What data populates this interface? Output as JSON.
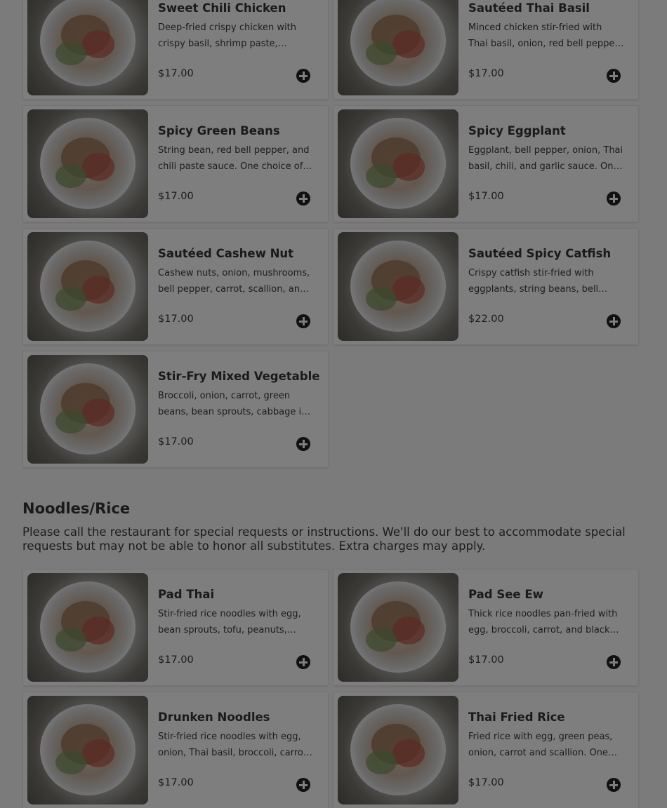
{
  "sections": [
    {
      "items": [
        {
          "name": "Sweet Chili Chicken",
          "desc": "Deep-fried crispy chicken with crispy basil, shrimp paste, sesame seeds and sweet chili sauce.",
          "price": "$17.00",
          "image": "dish-photo"
        },
        {
          "name": "Sautéed Thai Basil",
          "desc": "Minced chicken stir-fried with Thai basil, onion, red bell pepper, and chili garlic sauce.",
          "price": "$17.00",
          "image": "dish-photo"
        },
        {
          "name": "Spicy Green Beans",
          "desc": "String bean, red bell pepper, and chili paste sauce. One choice of protein.",
          "price": "$17.00",
          "image": "dish-photo"
        },
        {
          "name": "Spicy Eggplant",
          "desc": "Eggplant, bell pepper, onion, Thai basil, chili, and garlic sauce. One choice of protein.",
          "price": "$17.00",
          "image": "dish-photo"
        },
        {
          "name": "Sautéed Cashew Nut",
          "desc": "Cashew nuts, onion, mushrooms, bell pepper, carrot, scallion, and roasted chili sauce.",
          "price": "$17.00",
          "image": "dish-photo"
        },
        {
          "name": "Sautéed Spicy Catfish",
          "desc": "Crispy catfish stir-fried with eggplants, string beans, bell pepper and curry paste.",
          "price": "$22.00",
          "image": "dish-photo"
        },
        {
          "name": "Stir-Fry Mixed Vegetables",
          "desc": "Broccoli, onion, carrot, green beans, bean sprouts, cabbage in garlic sauce.",
          "price": "$17.00",
          "image": "dish-photo"
        }
      ]
    },
    {
      "title": "Noodles/Rice",
      "note": "Please call the restaurant for special requests or instructions. We'll do our best to accommodate special requests but may not be able to honor all substitutes. Extra charges may apply.",
      "items": [
        {
          "name": "Pad Thai",
          "desc": "Stir-fried rice noodles with egg, bean sprouts, tofu, peanuts, green onion and tamarind sauce.",
          "price": "$17.00",
          "image": "dish-photo"
        },
        {
          "name": "Pad See Ew",
          "desc": "Thick rice noodles pan-fried with egg, broccoli, carrot, and black soy sauce.",
          "price": "$17.00",
          "image": "dish-photo"
        },
        {
          "name": "Drunken Noodles",
          "desc": "Stir-fried rice noodles with egg, onion, Thai basil, broccoli, carrot, and chili sauce.",
          "price": "$17.00",
          "image": "dish-photo"
        },
        {
          "name": "Thai Fried Rice",
          "desc": "Fried rice with egg, green peas, onion, carrot and scallion. One choice of protein.",
          "price": "$17.00",
          "image": "dish-photo"
        }
      ]
    }
  ],
  "icons": {
    "add": "plus-circle-icon"
  },
  "colors": {
    "overlay_background": "#7b7b7b",
    "card_background": "#7e7e7e",
    "text": "#1e1e1e",
    "add_icon": "#111111"
  }
}
